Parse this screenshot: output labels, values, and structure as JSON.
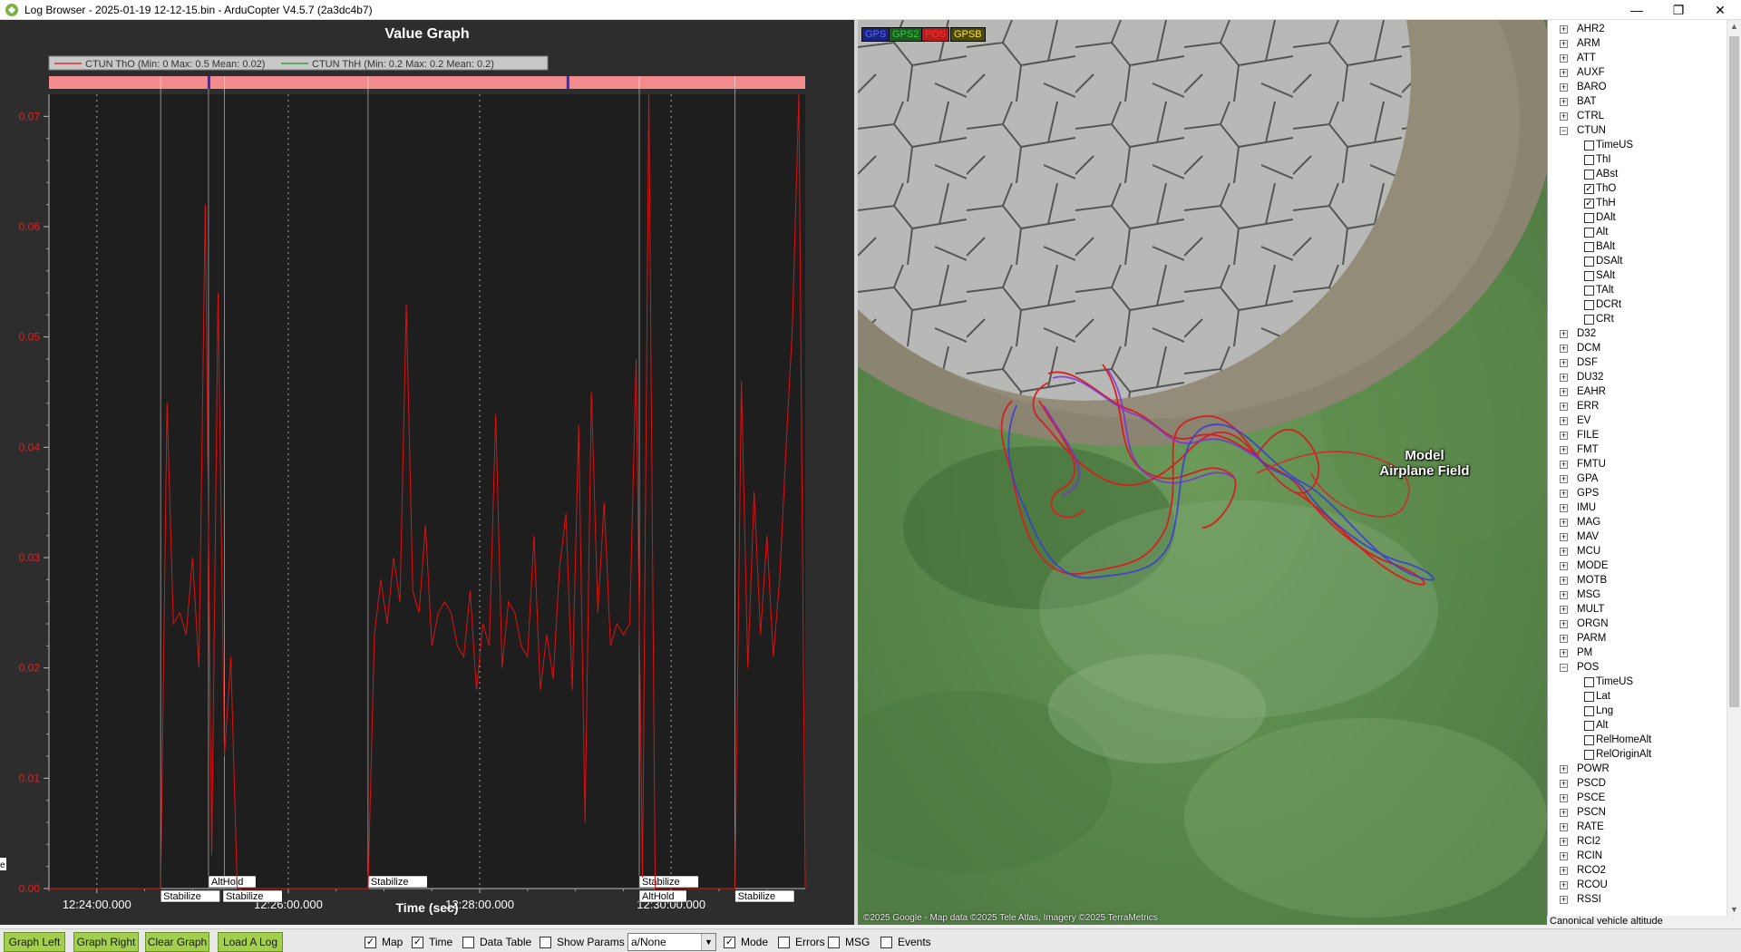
{
  "window": {
    "title": "Log Browser - 2025-01-19 12-12-15.bin - ArduCopter V4.5.7 (2a3dc4b7)",
    "minimize_glyph": "—",
    "maximize_glyph": "❐",
    "close_glyph": "✕"
  },
  "graph": {
    "title": "Value Graph",
    "xlabel": "Time (sec)",
    "legend": [
      {
        "label": "CTUN ThO  (Min: 0 Max: 0.5 Mean: 0.02)",
        "color": "#e03030"
      },
      {
        "label": "CTUN ThH  (Min: 0.2 Max: 0.2 Mean: 0.2)",
        "color": "#3aa03a"
      }
    ],
    "y_ticks": [
      "0.07",
      "0.06",
      "0.05",
      "0.04",
      "0.03",
      "0.02",
      "0.01",
      "0.00"
    ],
    "x_ticks": [
      "12:24:00.000",
      "12:26:00.000",
      "12:28:00.000",
      "12:30:00.000"
    ],
    "mode_labels_top": [
      "AltHold",
      "Stabilize",
      "Stabilize"
    ],
    "mode_labels_bottom": [
      "Stabilize",
      "Stabilize",
      "AltHold",
      "Stabilize"
    ],
    "left_edge_glyph": "e"
  },
  "chart_data": {
    "type": "line",
    "title": "Value Graph",
    "xlabel": "Time (sec)",
    "ylabel": "",
    "ylim": [
      0,
      0.072
    ],
    "x_ticks": [
      "12:24:00.000",
      "12:26:00.000",
      "12:28:00.000",
      "12:30:00.000"
    ],
    "grid": true,
    "series": [
      {
        "name": "CTUN ThO",
        "color": "#e03030",
        "x": [
          "12:23:30",
          "12:24:40",
          "12:24:44",
          "12:24:48",
          "12:24:52",
          "12:24:56",
          "12:25:00",
          "12:25:04",
          "12:25:08",
          "12:25:12",
          "12:25:16",
          "12:25:20",
          "12:25:24",
          "12:25:28",
          "12:25:32",
          "12:25:36",
          "12:25:40",
          "12:25:44",
          "12:25:48",
          "12:25:52",
          "12:26:50",
          "12:26:54",
          "12:26:58",
          "12:27:02",
          "12:27:06",
          "12:27:10",
          "12:27:14",
          "12:27:18",
          "12:27:22",
          "12:27:26",
          "12:27:30",
          "12:27:34",
          "12:27:38",
          "12:27:42",
          "12:27:46",
          "12:27:50",
          "12:27:54",
          "12:27:58",
          "12:28:02",
          "12:28:06",
          "12:28:10",
          "12:28:14",
          "12:28:18",
          "12:28:22",
          "12:28:26",
          "12:28:30",
          "12:28:34",
          "12:28:38",
          "12:28:42",
          "12:28:46",
          "12:28:50",
          "12:28:54",
          "12:28:58",
          "12:29:02",
          "12:29:06",
          "12:29:10",
          "12:29:14",
          "12:29:18",
          "12:29:22",
          "12:29:26",
          "12:29:30",
          "12:29:34",
          "12:29:38",
          "12:29:42",
          "12:29:46",
          "12:29:50",
          "12:29:54",
          "12:29:58",
          "12:30:40",
          "12:30:44",
          "12:30:48",
          "12:30:52",
          "12:30:56",
          "12:31:00",
          "12:31:04",
          "12:31:08",
          "12:31:12",
          "12:31:16",
          "12:31:20",
          "12:31:24"
        ],
        "values": [
          0,
          0,
          0.044,
          0.024,
          0.025,
          0.023,
          0.03,
          0.02,
          0.062,
          0.003,
          0.054,
          0.012,
          0.021,
          0,
          0,
          0,
          0,
          0,
          0,
          0,
          0,
          0.023,
          0.028,
          0.024,
          0.03,
          0.026,
          0.053,
          0.027,
          0.025,
          0.033,
          0.022,
          0.025,
          0.026,
          0.025,
          0.022,
          0.021,
          0.027,
          0.018,
          0.024,
          0.022,
          0.043,
          0.02,
          0.026,
          0.025,
          0.022,
          0.021,
          0.032,
          0.018,
          0.023,
          0.019,
          0.029,
          0.034,
          0.018,
          0.042,
          0.006,
          0.045,
          0.025,
          0.035,
          0.022,
          0.024,
          0.023,
          0.024,
          0.048,
          0.001,
          0.072,
          0,
          0,
          0,
          0,
          0.046,
          0.02,
          0.036,
          0.023,
          0.032,
          0.021,
          0.028,
          0.04,
          0.051,
          0.072,
          0
        ]
      },
      {
        "name": "CTUN ThH",
        "color": "#3aa03a",
        "x": [
          "12:23:30",
          "12:31:24"
        ],
        "values": [
          0.2,
          0.2
        ]
      }
    ],
    "mode_changes": [
      {
        "time": "12:24:40",
        "mode": "Stabilize"
      },
      {
        "time": "12:25:10",
        "mode": "AltHold"
      },
      {
        "time": "12:25:20",
        "mode": "Stabilize"
      },
      {
        "time": "12:26:50",
        "mode": "Stabilize"
      },
      {
        "time": "12:29:40",
        "mode": "Stabilize"
      },
      {
        "time": "12:29:40",
        "mode": "AltHold"
      },
      {
        "time": "12:30:40",
        "mode": "Stabilize"
      }
    ]
  },
  "map": {
    "legend": [
      {
        "label": "GPS",
        "bg": "#1a237e",
        "fg": "#4c6cff"
      },
      {
        "label": "GPS2",
        "bg": "#1b5e20",
        "fg": "#2ecc40"
      },
      {
        "label": "POS",
        "bg": "#b71c1c",
        "fg": "#ff3030"
      },
      {
        "label": "GPSB",
        "bg": "#4a4a00",
        "fg": "#ffe040"
      }
    ],
    "place_label_line1": "Model",
    "place_label_line2": "Airplane Field",
    "attribution": "©2025 Google - Map data ©2025 Tele Atlas, Imagery ©2025 TerraMetrics"
  },
  "tree": {
    "items": [
      {
        "label": "AHR2",
        "kind": "group"
      },
      {
        "label": "ARM",
        "kind": "group"
      },
      {
        "label": "ATT",
        "kind": "group"
      },
      {
        "label": "AUXF",
        "kind": "group"
      },
      {
        "label": "BARO",
        "kind": "group"
      },
      {
        "label": "BAT",
        "kind": "group"
      },
      {
        "label": "CTRL",
        "kind": "group"
      },
      {
        "label": "CTUN",
        "kind": "group-open"
      },
      {
        "label": "TimeUS",
        "kind": "field",
        "checked": false
      },
      {
        "label": "ThI",
        "kind": "field",
        "checked": false
      },
      {
        "label": "ABst",
        "kind": "field",
        "checked": false
      },
      {
        "label": "ThO",
        "kind": "field",
        "checked": true
      },
      {
        "label": "ThH",
        "kind": "field",
        "checked": true
      },
      {
        "label": "DAlt",
        "kind": "field",
        "checked": false
      },
      {
        "label": "Alt",
        "kind": "field",
        "checked": false
      },
      {
        "label": "BAlt",
        "kind": "field",
        "checked": false
      },
      {
        "label": "DSAlt",
        "kind": "field",
        "checked": false
      },
      {
        "label": "SAlt",
        "kind": "field",
        "checked": false
      },
      {
        "label": "TAlt",
        "kind": "field",
        "checked": false
      },
      {
        "label": "DCRt",
        "kind": "field",
        "checked": false
      },
      {
        "label": "CRt",
        "kind": "field",
        "checked": false
      },
      {
        "label": "D32",
        "kind": "group"
      },
      {
        "label": "DCM",
        "kind": "group"
      },
      {
        "label": "DSF",
        "kind": "group"
      },
      {
        "label": "DU32",
        "kind": "group"
      },
      {
        "label": "EAHR",
        "kind": "group"
      },
      {
        "label": "ERR",
        "kind": "group"
      },
      {
        "label": "EV",
        "kind": "group"
      },
      {
        "label": "FILE",
        "kind": "group"
      },
      {
        "label": "FMT",
        "kind": "group"
      },
      {
        "label": "FMTU",
        "kind": "group"
      },
      {
        "label": "GPA",
        "kind": "group"
      },
      {
        "label": "GPS",
        "kind": "group"
      },
      {
        "label": "IMU",
        "kind": "group"
      },
      {
        "label": "MAG",
        "kind": "group"
      },
      {
        "label": "MAV",
        "kind": "group"
      },
      {
        "label": "MCU",
        "kind": "group"
      },
      {
        "label": "MODE",
        "kind": "group"
      },
      {
        "label": "MOTB",
        "kind": "group"
      },
      {
        "label": "MSG",
        "kind": "group"
      },
      {
        "label": "MULT",
        "kind": "group"
      },
      {
        "label": "ORGN",
        "kind": "group"
      },
      {
        "label": "PARM",
        "kind": "group"
      },
      {
        "label": "PM",
        "kind": "group"
      },
      {
        "label": "POS",
        "kind": "group-open"
      },
      {
        "label": "TimeUS",
        "kind": "field",
        "checked": false
      },
      {
        "label": "Lat",
        "kind": "field",
        "checked": false
      },
      {
        "label": "Lng",
        "kind": "field",
        "checked": false
      },
      {
        "label": "Alt",
        "kind": "field",
        "checked": false
      },
      {
        "label": "RelHomeAlt",
        "kind": "field",
        "checked": false
      },
      {
        "label": "RelOriginAlt",
        "kind": "field",
        "checked": false
      },
      {
        "label": "POWR",
        "kind": "group"
      },
      {
        "label": "PSCD",
        "kind": "group"
      },
      {
        "label": "PSCE",
        "kind": "group"
      },
      {
        "label": "PSCN",
        "kind": "group"
      },
      {
        "label": "RATE",
        "kind": "group"
      },
      {
        "label": "RCI2",
        "kind": "group"
      },
      {
        "label": "RCIN",
        "kind": "group"
      },
      {
        "label": "RCO2",
        "kind": "group"
      },
      {
        "label": "RCOU",
        "kind": "group"
      },
      {
        "label": "RSSI",
        "kind": "group"
      }
    ],
    "status": "Canonical vehicle altitude"
  },
  "toolbar": {
    "graph_left": "Graph Left",
    "graph_right": "Graph Right",
    "clear_graph": "Clear Graph",
    "load_log": "Load A Log",
    "checkboxes": [
      {
        "label": "Map",
        "checked": true
      },
      {
        "label": "Time",
        "checked": true
      },
      {
        "label": "Data Table",
        "checked": false
      },
      {
        "label": "Show Params",
        "checked": false
      }
    ],
    "mode_select_value": "a/None",
    "checkboxes2": [
      {
        "label": "Mode",
        "checked": true
      },
      {
        "label": "Errors",
        "checked": false
      },
      {
        "label": "MSG",
        "checked": false
      },
      {
        "label": "Events",
        "checked": false
      }
    ]
  },
  "colors": {
    "accent_button": "#a3d04c",
    "graph_bg": "#1e1e1e",
    "plot_line": "#e01010"
  }
}
